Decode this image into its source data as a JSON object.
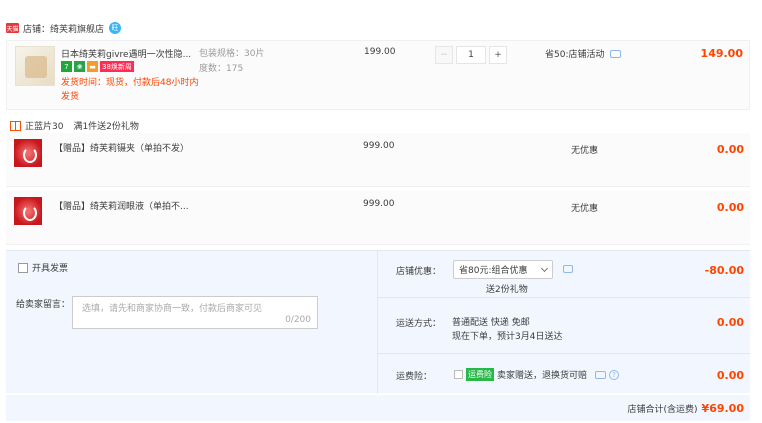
{
  "shop": {
    "name": "店铺：绮芙莉旗舰店",
    "badge": "天猫",
    "ww": "旺"
  },
  "item": {
    "title": "日本绮芙莉givre遇明一次性隐...",
    "tags": [
      "7",
      "❀",
      "▬",
      "38焕新周"
    ],
    "ship_note": "发货时间：现货，付款后48小时内发货",
    "spec_lines": [
      "包装规格：30片",
      "度数：175"
    ],
    "unit_price": "199.00",
    "qty": "1",
    "minus": "−",
    "plus": "+",
    "promo": "省50:店铺活动",
    "total": "149.00"
  },
  "gift_header": {
    "label": "正蓝片30",
    "promo": "满1件送2份礼物"
  },
  "gifts": [
    {
      "title": "【赠品】绮芙莉镊夹（单拍不发）",
      "price": "999.00",
      "discount": "无优惠",
      "total": "0.00"
    },
    {
      "title": "【赠品】绮芙莉润眼液（单拍不...",
      "price": "999.00",
      "discount": "无优惠",
      "total": "0.00"
    }
  ],
  "panel": {
    "invoice": "开具发票",
    "msg_label": "给卖家留言：",
    "msg_placeholder": "选填，请先和商家协商一致，付款后商家可见",
    "msg_count": "0/200",
    "coupon_label": "店铺优惠：",
    "coupon_value": "省80元:组合优惠",
    "coupon_gift": "送2份礼物",
    "coupon_amount": "-80.00",
    "ship_label": "运送方式：",
    "ship_line1": "普通配送 快递 免邮",
    "ship_line2": "现在下单，预计3月4日送达",
    "ship_amount": "0.00",
    "ins_label": "运费险：",
    "ins_badge": "运费险",
    "ins_text": "卖家赠送，退换货可赔",
    "ins_help": "?",
    "ins_amount": "0.00"
  },
  "summary": {
    "label": "店铺合计(含运费)",
    "value": "¥69.00"
  }
}
